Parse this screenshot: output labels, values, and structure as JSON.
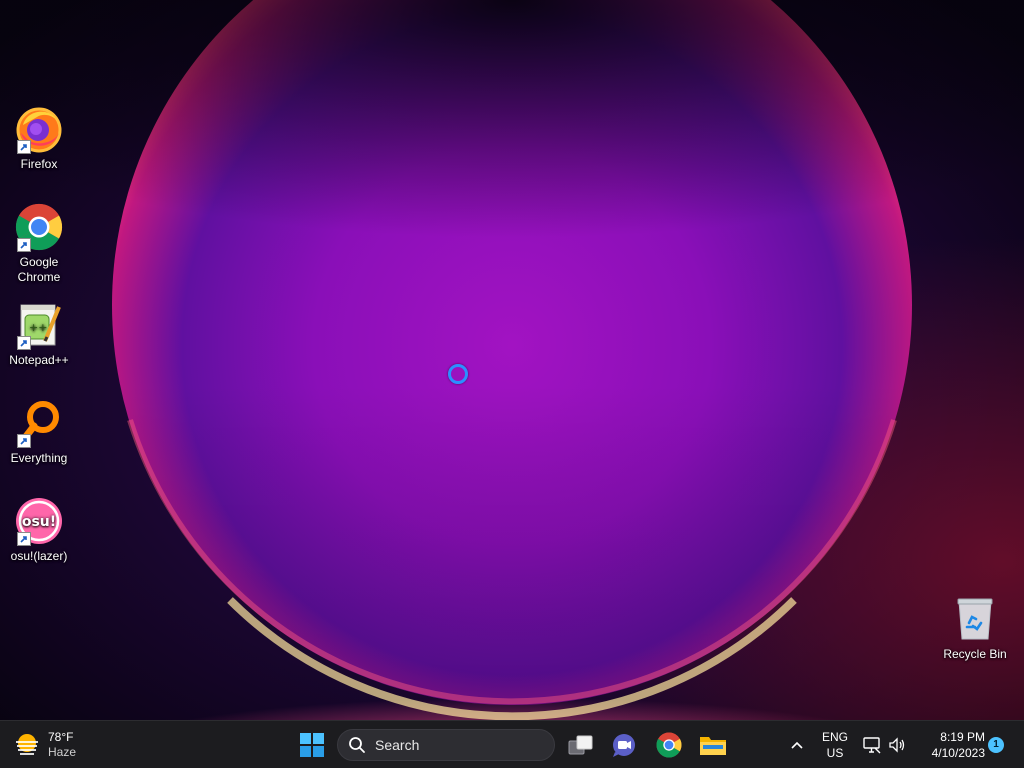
{
  "desktop": {
    "icons": [
      {
        "label": "Firefox",
        "icon": "firefox-icon"
      },
      {
        "label": "Google Chrome",
        "icon": "chrome-icon"
      },
      {
        "label": "Notepad++",
        "icon": "notepad-plus-plus-icon"
      },
      {
        "label": "Everything",
        "icon": "everything-search-icon"
      },
      {
        "label": "osu!(lazer)",
        "icon": "osu-icon"
      },
      {
        "label": "Recycle Bin",
        "icon": "recycle-bin-icon"
      }
    ],
    "osu_logo_text": "osu!"
  },
  "taskbar": {
    "weather": {
      "temp": "78°F",
      "condition": "Haze",
      "icon": "haze-weather-icon"
    },
    "start_icon": "windows-logo-icon",
    "search_label": "Search",
    "apps": [
      {
        "name": "Task View",
        "icon": "task-view-icon"
      },
      {
        "name": "Teams Chat",
        "icon": "teams-chat-icon"
      },
      {
        "name": "Google Chrome",
        "icon": "chrome-icon"
      },
      {
        "name": "File Explorer",
        "icon": "file-explorer-icon"
      }
    ],
    "tray": {
      "language_line1": "ENG",
      "language_line2": "US",
      "time": "8:19 PM",
      "date": "4/10/2023",
      "notification_count": "1"
    }
  },
  "colors": {
    "taskbar_bg": "#1c1c1f",
    "accent": "#4cc2ff",
    "busy_cursor": "#2b8fff"
  }
}
